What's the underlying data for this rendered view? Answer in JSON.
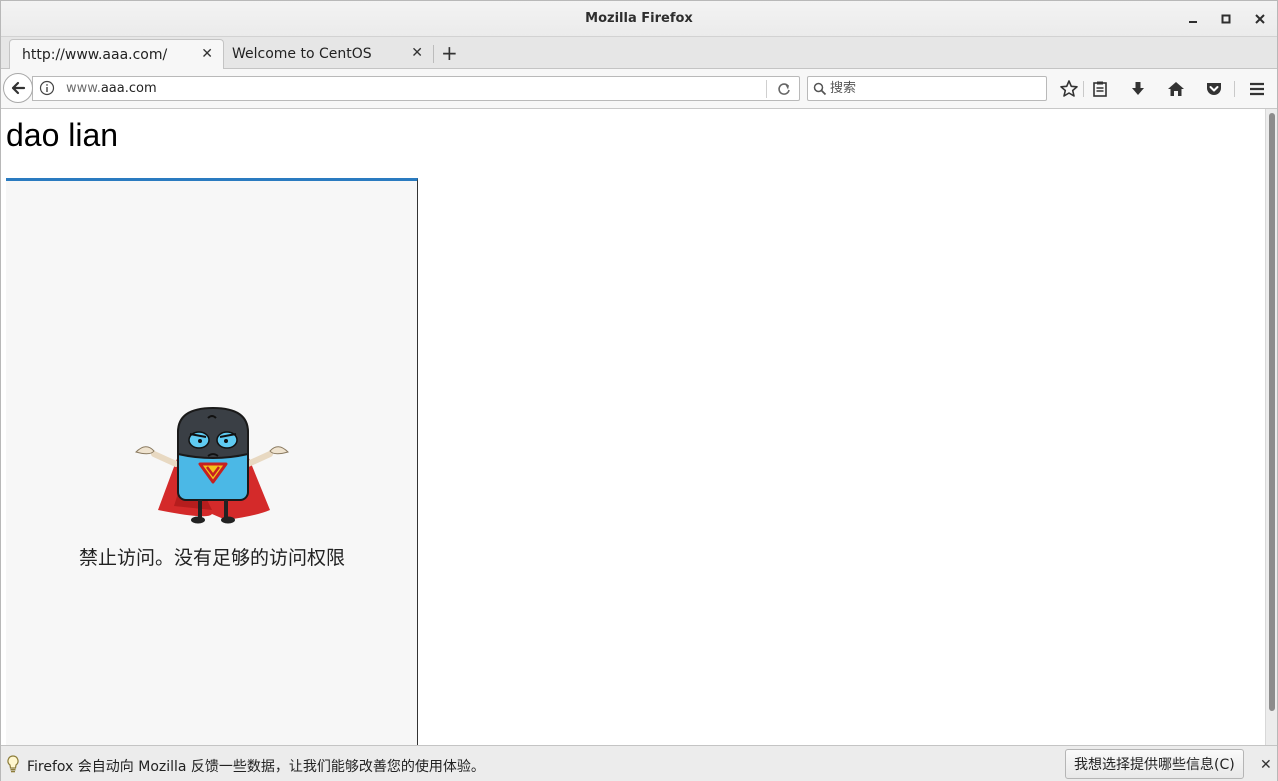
{
  "window": {
    "title": "Mozilla Firefox"
  },
  "tabs": [
    {
      "label": "http://www.aaa.com/",
      "active": true
    },
    {
      "label": "Welcome to CentOS",
      "active": false
    }
  ],
  "newtab_label": "+",
  "urlbar": {
    "prefix": "www.",
    "domain": "aaa.com"
  },
  "search": {
    "placeholder": "搜索"
  },
  "toolbar_icons": [
    "bookmark-star-icon",
    "reading-list-icon",
    "downloads-icon",
    "home-icon",
    "pocket-icon",
    "menu-icon"
  ],
  "page": {
    "heading": "dao lian",
    "frame": {
      "message": "禁止访问。没有足够的访问权限",
      "accent": "#2a7bc0"
    }
  },
  "notification": {
    "message": "Firefox 会自动向 Mozilla 反馈一些数据，让我们能够改善您的使用体验。",
    "button_label": "我想选择提供哪些信息(C)"
  }
}
